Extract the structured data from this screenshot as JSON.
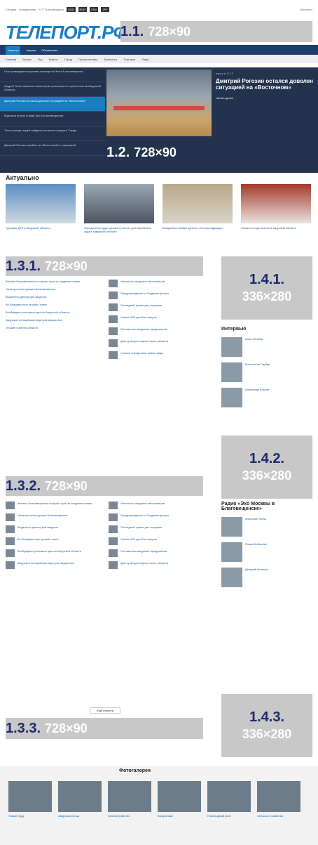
{
  "topbar": {
    "date": "Сегодня",
    "weekday": "понедельник",
    "weather": "+17° Благовещенск",
    "usd": "USD",
    "eur": "EUR",
    "cny": "CNY",
    "jpy": "JPY",
    "contacts": "Контакты"
  },
  "logo": "ТЕЛЕПОРТ.РФ",
  "ads": {
    "a1": {
      "num": "1.1.",
      "size": "728×90"
    },
    "a2": {
      "num": "1.2.",
      "size": "728×90"
    },
    "a31": {
      "num": "1.3.1.",
      "size": "728×90"
    },
    "a32": {
      "num": "1.3.2.",
      "size": "728×90"
    },
    "a33": {
      "num": "1.3.3.",
      "size": "728×90"
    },
    "a41": {
      "num": "1.4.1.",
      "size": "336×280"
    },
    "a42": {
      "num": "1.4.2.",
      "size": "336×280"
    },
    "a43": {
      "num": "1.4.3.",
      "size": "336×280"
    }
  },
  "nav": [
    "Новости",
    "Афиша",
    "Объявления"
  ],
  "subnav": [
    "Главная",
    "Бизнес",
    "Вуз",
    "Власть",
    "Город",
    "Происшествия",
    "Транспорт",
    "Торговля",
    "Люди"
  ],
  "hero": {
    "items": [
      "Газы утверждают мужчины жилище из Зея в Благовещенске",
      "Андрей Тапко назначен министром транспорта и строительства Амурской области",
      "Дмитрий Рогозин остался доволен ситуацией на «Восточном»",
      "Мужчина утонул в воде Зея в Благовещенске",
      "Точно всегда людей найдены на месте пожара в Тынде",
      "Дмитрий Рогозин прибыл на «Восточный» с проверкой"
    ],
    "meta": "вчера в 17:19",
    "title": "Дмитрий Рогозин остался доволен ситуацией на «Восточном»",
    "more": "Читать далее"
  },
  "actual": {
    "title": "Актуально",
    "items": [
      "Грузовик ДТП в Амурской области",
      "Определены суды приняли участие для выплатные суда в Амурской области",
      "Бездомные собаки приюта «Остров надежды»",
      "Сюжеты на депозитах в амурской области"
    ]
  },
  "feed_left": [
    "Житель Благовещенска получил срок за создание схемы",
    "Начата реконструкция Благовещенска",
    "Выделены деньги для амурчан",
    "Во Владивостоке прошёл совет",
    "Возбуждено уголовное дело в Амурской области",
    "Амурские полицейские вернули имущество",
    "Лучшие учителя области"
  ],
  "feed_right": [
    "Несколько амурских пенсионеров",
    "Предупреждение от Гидрометцентра",
    "Последний транш для аграриев",
    "Свыше 600 детей в лагерях",
    "Поставлены амурские предприятия",
    "Дом культуры открыт после ремонта",
    "Ученые определили новые виды"
  ],
  "interview": {
    "title": "Интервью",
    "people": [
      "Илья Рогачев",
      "Константин Гарбар",
      "Александр Козлов"
    ]
  },
  "radio": {
    "title": "Радио «Эхо Москвы в Благовещенске»",
    "people": [
      "Анатолий Тепак",
      "Роман Кобылкин",
      "Дмитрий Нетепрь"
    ]
  },
  "more": "Ещё новости",
  "gallery": {
    "title": "Фотогалерея",
    "captions": [
      "Новый пруд",
      "Амурская улица",
      "Благоустройство",
      "Выпускники",
      "Пешеходный мост",
      "Сельское хозяйство"
    ]
  }
}
